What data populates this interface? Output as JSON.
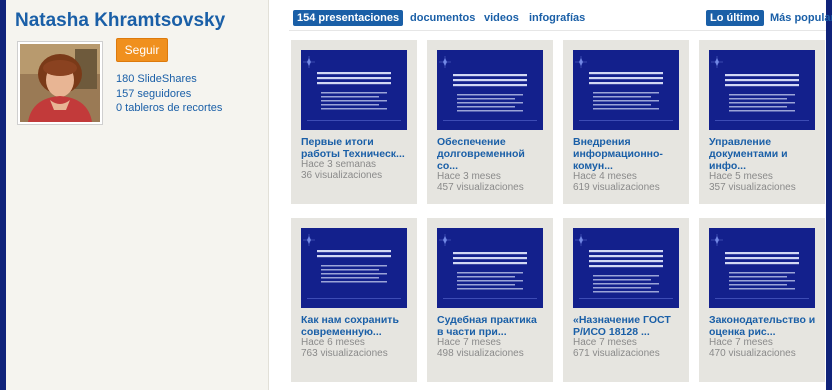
{
  "profile": {
    "name": "Natasha Khramtsovsky",
    "follow_label": "Seguir",
    "stats": [
      "180 SlideShares",
      "157 seguidores",
      "0 tableros de recortes"
    ]
  },
  "tabs": [
    {
      "label": "154 presentaciones",
      "active": true
    },
    {
      "label": "documentos",
      "active": false
    },
    {
      "label": "videos",
      "active": false
    },
    {
      "label": "infografías",
      "active": false
    }
  ],
  "sort": [
    {
      "label": "Lo último",
      "active": true
    },
    {
      "label": "Más popular",
      "active": false
    }
  ],
  "colors": {
    "accent": "#1a5fa7",
    "follow": "#f0901e",
    "page_bg": "#10237a",
    "slide_bg": "#13208c"
  },
  "cards": [
    {
      "title_lines": [
        "Первые итоги",
        "работы Техническ..."
      ],
      "age": "Hace 3 semanas",
      "views": "36 visualizaciones"
    },
    {
      "title_lines": [
        "Обеспечение",
        "долговременной",
        "со..."
      ],
      "age": "Hace 3 meses",
      "views": "457 visualizaciones"
    },
    {
      "title_lines": [
        "Внедрения",
        "информационно-",
        "комун..."
      ],
      "age": "Hace 4 meses",
      "views": "619 visualizaciones"
    },
    {
      "title_lines": [
        "Управление",
        "документами и",
        "инфо..."
      ],
      "age": "Hace 5 meses",
      "views": "357 visualizaciones"
    },
    {
      "title_lines": [
        "Как нам сохранить",
        "современную..."
      ],
      "age": "Hace 6 meses",
      "views": "763 visualizaciones"
    },
    {
      "title_lines": [
        "Судебная практика",
        "в части при..."
      ],
      "age": "Hace 7 meses",
      "views": "498 visualizaciones"
    },
    {
      "title_lines": [
        "«Назначение ГОСТ",
        "Р/ИСО 18128 ..."
      ],
      "age": "Hace 7 meses",
      "views": "671 visualizaciones"
    },
    {
      "title_lines": [
        "Законодательство и",
        "оценка рис..."
      ],
      "age": "Hace 7 meses",
      "views": "470 visualizaciones"
    }
  ]
}
